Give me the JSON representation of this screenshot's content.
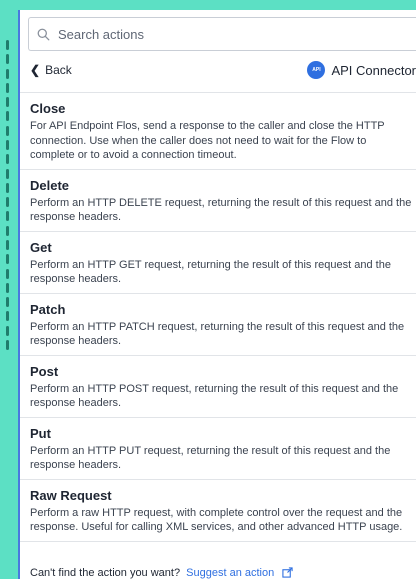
{
  "search": {
    "placeholder": "Search actions"
  },
  "nav": {
    "back_label": "Back"
  },
  "connector": {
    "name": "API Connector",
    "badge_text": "API"
  },
  "actions": [
    {
      "title": "Close",
      "description": "For API Endpoint Flos, send a response to the caller and close the HTTP connection. Use when the caller does not need to wait for the Flow to complete or to avoid a connection timeout."
    },
    {
      "title": "Delete",
      "description": "Perform an HTTP DELETE request, returning the result of this request and the response headers."
    },
    {
      "title": "Get",
      "description": "Perform an HTTP GET request, returning the result of this request and the response headers."
    },
    {
      "title": "Patch",
      "description": "Perform an HTTP PATCH request, returning the result of this request and the response headers."
    },
    {
      "title": "Post",
      "description": "Perform an HTTP POST request, returning the result of this request and the response headers."
    },
    {
      "title": "Put",
      "description": "Perform an HTTP PUT request, returning the result of this request and the response headers."
    },
    {
      "title": "Raw Request",
      "description": "Perform a raw HTTP request, with complete control over the request and the response. Useful for calling XML services, and other advanced HTTP usage."
    }
  ],
  "footer": {
    "text": "Can't find the action you want?",
    "link_label": "Suggest an action"
  },
  "colors": {
    "background": "#5ce0c4",
    "accent": "#2f6fe0",
    "panel_border": "#4a79df"
  },
  "icons": {
    "search": "search-icon",
    "back": "chevron-left-icon",
    "connector": "api-connector-icon",
    "external": "external-link-icon"
  }
}
